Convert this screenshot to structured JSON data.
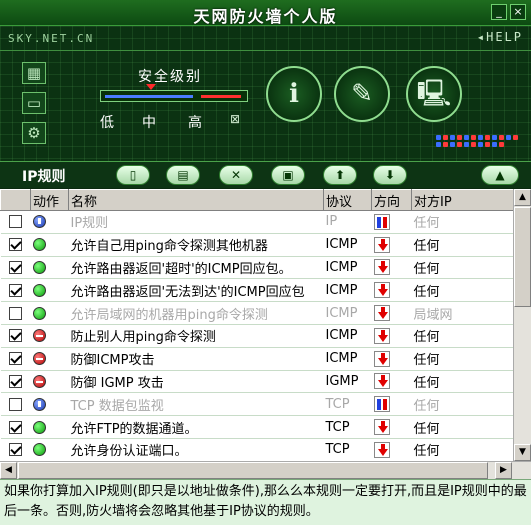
{
  "window": {
    "title": "天网防火墙个人版",
    "minimize_glyph": "_",
    "close_glyph": "×"
  },
  "header": {
    "brand": "SKY.NET.CN",
    "help": "HELP",
    "security_level": {
      "title": "安全级别",
      "levels": [
        "低",
        "中",
        "高",
        "⊠"
      ],
      "current": "中"
    },
    "left_icons": [
      "grid-icon",
      "network-card-icon",
      "gear-icon"
    ],
    "round_buttons": [
      {
        "name": "info-icon",
        "glyph": "ℹ"
      },
      {
        "name": "pencil-icon",
        "glyph": "✎"
      },
      {
        "name": "computers-icon",
        "glyph": "🖳"
      }
    ]
  },
  "toolbar": {
    "title": "IP规则",
    "buttons": [
      {
        "name": "add-rule-icon",
        "glyph": "▯"
      },
      {
        "name": "edit-rule-icon",
        "glyph": "▤"
      },
      {
        "name": "delete-rule-icon",
        "glyph": "✕"
      },
      {
        "name": "save-rules-icon",
        "glyph": "▣"
      },
      {
        "name": "move-up-icon",
        "glyph": "⬆"
      },
      {
        "name": "move-down-icon",
        "glyph": "⬇"
      },
      {
        "name": "collapse-icon",
        "glyph": "▲"
      }
    ]
  },
  "table": {
    "columns": [
      "动作",
      "名称",
      "协议",
      "方向",
      "对方IP"
    ],
    "rows": [
      {
        "checked": false,
        "action": "both",
        "name": "IP规则",
        "protocol": "IP",
        "direction": "both",
        "remote": "任何",
        "disabled": true
      },
      {
        "checked": true,
        "action": "allow",
        "name": "允许自己用ping命令探测其他机器",
        "protocol": "ICMP",
        "direction": "in",
        "remote": "任何",
        "disabled": false
      },
      {
        "checked": true,
        "action": "allow",
        "name": "允许路由器返回'超时'的ICMP回应包。",
        "protocol": "ICMP",
        "direction": "in",
        "remote": "任何",
        "disabled": false
      },
      {
        "checked": true,
        "action": "allow",
        "name": "允许路由器返回'无法到达'的ICMP回应包",
        "protocol": "ICMP",
        "direction": "in",
        "remote": "任何",
        "disabled": false
      },
      {
        "checked": false,
        "action": "allow",
        "name": "允许局域网的机器用ping命令探测",
        "protocol": "ICMP",
        "direction": "in",
        "remote": "局域网",
        "disabled": true
      },
      {
        "checked": true,
        "action": "deny",
        "name": "防止别人用ping命令探测",
        "protocol": "ICMP",
        "direction": "in",
        "remote": "任何",
        "disabled": false
      },
      {
        "checked": true,
        "action": "deny",
        "name": "防御ICMP攻击",
        "protocol": "ICMP",
        "direction": "in",
        "remote": "任何",
        "disabled": false
      },
      {
        "checked": true,
        "action": "deny",
        "name": "防御 IGMP 攻击",
        "protocol": "IGMP",
        "direction": "in",
        "remote": "任何",
        "disabled": false
      },
      {
        "checked": false,
        "action": "both",
        "name": "TCP 数据包监视",
        "protocol": "TCP",
        "direction": "both",
        "remote": "任何",
        "disabled": true
      },
      {
        "checked": true,
        "action": "allow",
        "name": "允许FTP的数据通道。",
        "protocol": "TCP",
        "direction": "in",
        "remote": "任何",
        "disabled": false
      },
      {
        "checked": true,
        "action": "allow",
        "name": "允许身份认证端口。",
        "protocol": "TCP",
        "direction": "in",
        "remote": "任何",
        "disabled": false
      }
    ]
  },
  "description": "如果你打算加入IP规则(即只是以地址做条件),那么么本规则一定要打开,而且是IP规则中的最后一条。否则,防火墙将会忽略其他基于IP协议的规则。",
  "colors": {
    "panel_bg": "#0b3212",
    "grid": "#50a050",
    "allow": "#0a9a0a",
    "deny": "#b00000",
    "both": "#1536b0",
    "desc_bg": "#dff3df"
  }
}
